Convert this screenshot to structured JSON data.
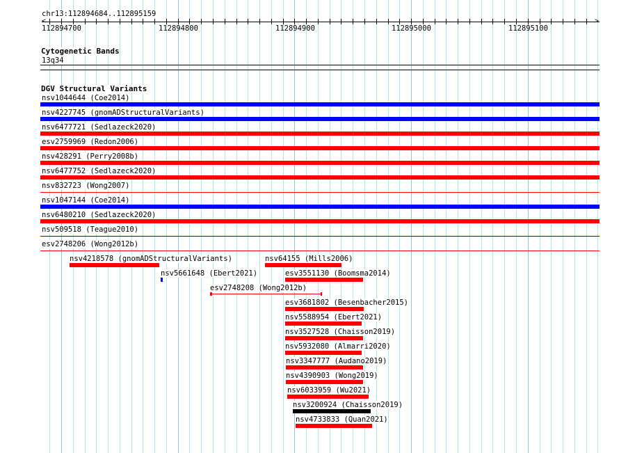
{
  "locus": "chr13:112894684..112895159",
  "ruler": {
    "labels": [
      "112894700",
      "112894800",
      "112894900",
      "112895000",
      "112895100"
    ]
  },
  "cytobands": {
    "title": "Cytogenetic Bands",
    "band": "13q34"
  },
  "dgv": {
    "title": "DGV Structural Variants",
    "colors": {
      "loss": "#ff0000",
      "gain": "#0000ff",
      "other": "#000000"
    },
    "full_rows": [
      {
        "label": "nsv1044644 (Coe2014)",
        "color": "#0000ff",
        "style": "thick"
      },
      {
        "label": "nsv4227745 (gnomADStructuralVariants)",
        "color": "#0000ff",
        "style": "thick"
      },
      {
        "label": "nsv6477721 (Sedlazeck2020)",
        "color": "#ff0000",
        "style": "thick"
      },
      {
        "label": "esv2759969 (Redon2006)",
        "color": "#ff0000",
        "style": "thick"
      },
      {
        "label": "nsv428291 (Perry2008b)",
        "color": "#ff0000",
        "style": "thick"
      },
      {
        "label": "nsv6477752 (Sedlazeck2020)",
        "color": "#ff0000",
        "style": "thick"
      },
      {
        "label": "nsv832723 (Wong2007)",
        "color": "#ff0000",
        "style": "thin"
      },
      {
        "label": "nsv1047144 (Coe2014)",
        "color": "#0000ff",
        "style": "thick"
      },
      {
        "label": "nsv6480210 (Sedlazeck2020)",
        "color": "#ff0000",
        "style": "thick"
      },
      {
        "label": "nsv509518 (Teague2010)",
        "color": "#0000ff",
        "style": "thin"
      },
      {
        "label": "esv2748206 (Wong2012b)",
        "color": "#ff0000",
        "style": "thin"
      }
    ],
    "features": [
      {
        "label": "nsv4218578 (gnomADStructuralVariants)",
        "color": "#ff0000",
        "style": "thick"
      },
      {
        "label": "nsv64155 (Mills2006)",
        "color": "#ff0000",
        "style": "thick"
      },
      {
        "label": "nsv5661648 (Ebert2021)",
        "color": "#0000ff",
        "style": "thick"
      },
      {
        "label": "esv3551130 (Boomsma2014)",
        "color": "#ff0000",
        "style": "thick"
      },
      {
        "label": "esv2748208 (Wong2012b)",
        "color": "#ff0000",
        "style": "line"
      },
      {
        "label": "esv3681802 (Besenbacher2015)",
        "color": "#ff0000",
        "style": "thick"
      },
      {
        "label": "nsv5588954 (Ebert2021)",
        "color": "#ff0000",
        "style": "thick"
      },
      {
        "label": "nsv3527528 (Chaisson2019)",
        "color": "#ff0000",
        "style": "thick"
      },
      {
        "label": "nsv5932080 (Almarri2020)",
        "color": "#ff0000",
        "style": "thick"
      },
      {
        "label": "nsv3347777 (Audano2019)",
        "color": "#ff0000",
        "style": "thick"
      },
      {
        "label": "nsv4390903 (Wong2019)",
        "color": "#ff0000",
        "style": "thick"
      },
      {
        "label": "nsv6033959 (Wu2021)",
        "color": "#ff0000",
        "style": "thick"
      },
      {
        "label": "nsv3200924 (Chaisson2019)",
        "color": "#000000",
        "style": "thick"
      },
      {
        "label": "nsv4733833 (Quan2021)",
        "color": "#ff0000",
        "style": "thick"
      }
    ]
  }
}
